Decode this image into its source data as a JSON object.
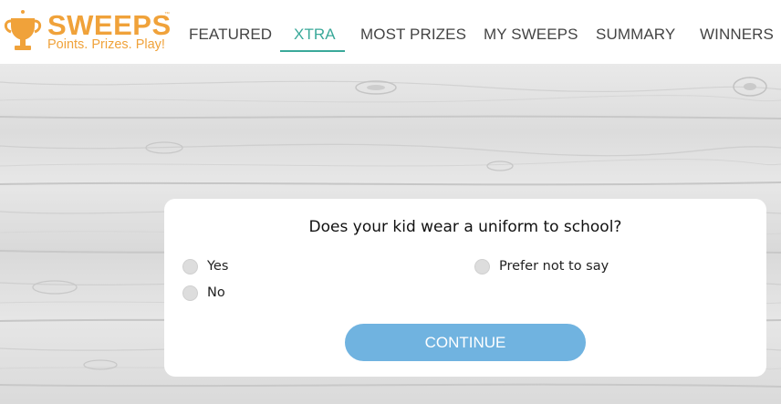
{
  "brand": {
    "name": "SWEEPS",
    "trademark": "™",
    "tagline": "Points. Prizes. Play!",
    "color": "#f0a23a"
  },
  "nav": {
    "active_color": "#3aa99a",
    "items": [
      {
        "label": "FEATURED"
      },
      {
        "label": "XTRA",
        "active": true
      },
      {
        "label": "MOST PRIZES"
      },
      {
        "label": "MY SWEEPS"
      },
      {
        "label": "SUMMARY"
      },
      {
        "label": "WINNERS"
      }
    ]
  },
  "survey": {
    "question": "Does your kid wear a uniform to school?",
    "options": [
      {
        "label": "Yes",
        "selected": false
      },
      {
        "label": "Prefer not to say",
        "selected": false
      },
      {
        "label": "No",
        "selected": false
      }
    ],
    "continue_label": "CONTINUE",
    "button_color": "#70b3e0"
  },
  "background": {
    "style": "white wood planks"
  }
}
